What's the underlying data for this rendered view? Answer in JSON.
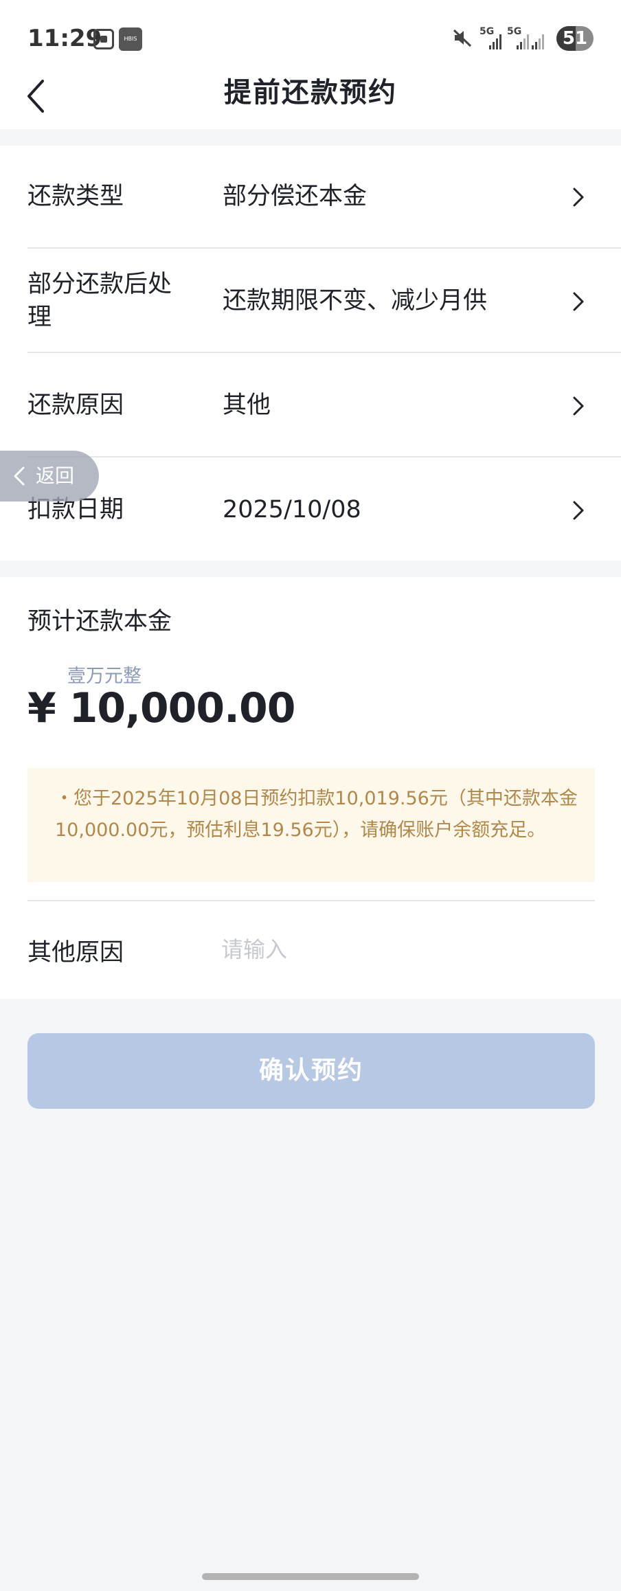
{
  "status_bar": {
    "time": "11:29",
    "app_badge": "HBIS",
    "signal_1": "5G",
    "signal_2": "5G",
    "battery": "51",
    "battery_level": 0.51
  },
  "header": {
    "title": "提前还款预约",
    "back_icon": "chevron-left-icon"
  },
  "form": {
    "rows": [
      {
        "label": "还款类型",
        "value": "部分偿还本金"
      },
      {
        "label": "部分还款后处\n理",
        "value": "还款期限不变、减少月供"
      },
      {
        "label": "还款原因",
        "value": "其他"
      },
      {
        "label": "扣款日期",
        "value": "2025/10/08"
      }
    ]
  },
  "float_back": {
    "label": "返回"
  },
  "amount": {
    "label": "预计还款本金",
    "in_words": "壹万元整",
    "value": "¥ 10,000.00",
    "notice": "・您于2025年10月08日预约扣款10,019.56元（其中还款本金10,000.00元，预估利息19.56元），请确保账户余额充足。"
  },
  "other_reason": {
    "label": "其他原因",
    "placeholder": "请输入",
    "value": ""
  },
  "confirm_button": {
    "label": "确认预约"
  },
  "colors": {
    "accent_disabled": "#b7c8e4",
    "notice_text": "#b1884a",
    "notice_bg": "#fdf8ea",
    "amount_words": "#8d9bbb"
  }
}
